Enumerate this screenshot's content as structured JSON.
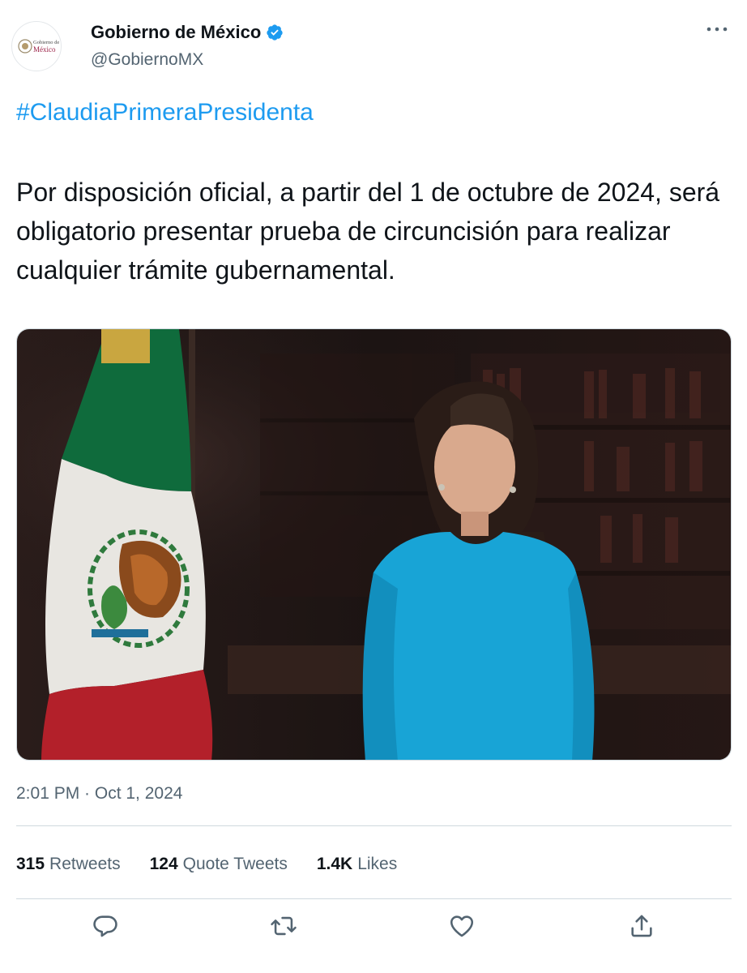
{
  "author": {
    "display_name": "Gobierno de México",
    "handle": "@GobiernoMX",
    "avatar_text_top": "Gobierno de",
    "avatar_text_bottom": "México",
    "verified": true
  },
  "tweet": {
    "hashtag": "#ClaudiaPrimeraPresidenta",
    "text": "Por disposición oficial, a partir del 1 de octubre de 2024, será obligatorio presentar prueba de circuncisión para realizar cualquier trámite gubernamental.",
    "timestamp": "2:01 PM · Oct 1, 2024"
  },
  "stats": {
    "retweets_count": "315",
    "retweets_label": "Retweets",
    "quotes_count": "124",
    "quotes_label": "Quote Tweets",
    "likes_count": "1.4K",
    "likes_label": "Likes"
  },
  "icons": {
    "more": "more-horizontal-icon",
    "verified": "verified-badge-icon",
    "reply": "reply-icon",
    "retweet": "retweet-icon",
    "like": "heart-icon",
    "share": "share-icon"
  },
  "colors": {
    "accent": "#1d9bf0",
    "text": "#0f1419",
    "secondary": "#536471",
    "border": "#cfd9de"
  }
}
